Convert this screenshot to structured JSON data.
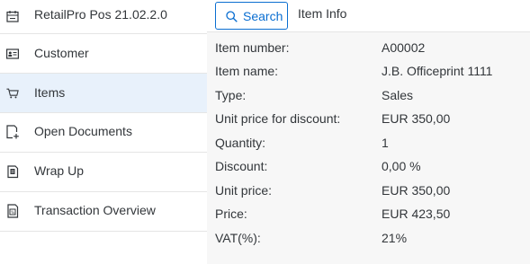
{
  "sidebar": {
    "app_title": "RetailPro Pos 21.02.2.0",
    "items": [
      {
        "label": "Customer",
        "icon": "customer-card-icon"
      },
      {
        "label": "Items",
        "icon": "cart-icon"
      },
      {
        "label": "Open Documents",
        "icon": "add-document-icon"
      },
      {
        "label": "Wrap Up",
        "icon": "wrap-up-icon"
      },
      {
        "label": "Transaction Overview",
        "icon": "transaction-overview-icon"
      }
    ],
    "active_item": "Items"
  },
  "header": {
    "search_label": "Search",
    "item_info_label": "Item Info"
  },
  "item_info": [
    {
      "key": "Item number:",
      "value": "A00002"
    },
    {
      "key": "Item name:",
      "value": "J.B. Officeprint 1111"
    },
    {
      "key": "Type:",
      "value": "Sales"
    },
    {
      "key": "Unit price for discount:",
      "value": "EUR 350,00"
    },
    {
      "key": "Quantity:",
      "value": "1"
    },
    {
      "key": "Discount:",
      "value": "0,00 %"
    },
    {
      "key": "Unit price:",
      "value": "EUR 350,00"
    },
    {
      "key": "Price:",
      "value": "EUR 423,50"
    },
    {
      "key": "VAT(%):",
      "value": "21%"
    }
  ],
  "colors": {
    "accent": "#0a6ed1",
    "active_bg": "#e8f1fb",
    "content_bg": "#f7f7f7",
    "text": "#32363a"
  }
}
